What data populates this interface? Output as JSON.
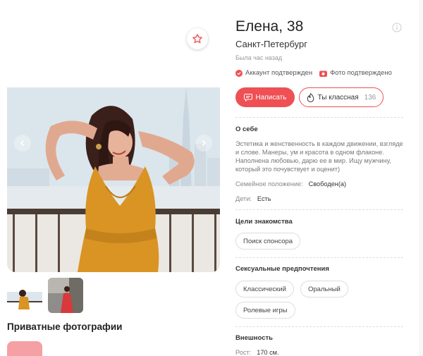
{
  "profile": {
    "name": "Елена, 38",
    "city": "Санкт-Петербург",
    "last_seen": "Была час назад",
    "verified_account": "Аккаунт подтвержден",
    "verified_photo": "Фото подтверждено"
  },
  "actions": {
    "write_label": "Написать",
    "like_label": "Ты классная",
    "like_count": "136"
  },
  "about": {
    "title": "О себе",
    "text": "Эстетика и женственность в каждом движении, взгляде и слове. Манеры, ум и красота в одном флаконе. Наполнена любовью, дарю ее в мир. Ищу мужчину, который это почувствует и оценит)",
    "marital_label": "Семейное положение:",
    "marital_value": "Свободен(а)",
    "kids_label": "Дети:",
    "kids_value": "Есть"
  },
  "goals": {
    "title": "Цели знакомства",
    "chips": [
      "Поиск спонсора"
    ]
  },
  "preferences": {
    "title": "Сексуальные предпочтения",
    "chips": [
      "Классический",
      "Оральный",
      "Ролевые игры"
    ]
  },
  "appearance": {
    "title": "Внешность",
    "height_label": "Рост:",
    "height_value": "170 см."
  },
  "gallery": {
    "private_title": "Приватные фотографии"
  },
  "colors": {
    "accent": "#ee5054",
    "dress": "#d99424",
    "chip_border": "#dddddd"
  },
  "icons": {
    "favorite": "star-icon",
    "info": "info-icon",
    "verified": "check-circle-icon",
    "photo_verified": "camera-icon",
    "chat": "chat-bubble-icon",
    "like": "flame-icon",
    "prev": "chevron-left-icon",
    "next": "chevron-right-icon"
  }
}
